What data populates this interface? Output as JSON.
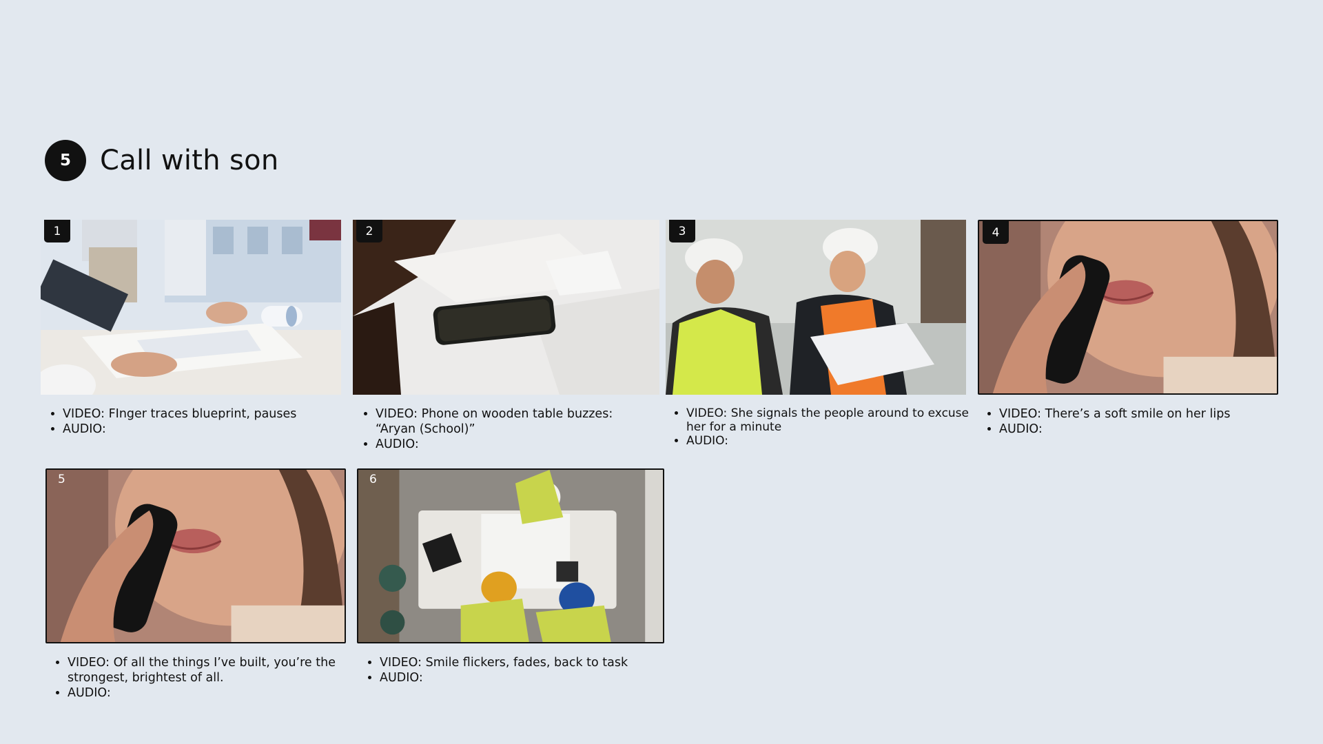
{
  "scene": {
    "number": "5",
    "title": "Call with son"
  },
  "shots": [
    {
      "number": "1",
      "image": "hands-on-blueprint-image",
      "video": "VIDEO: FInger traces blueprint, pauses",
      "video_cont": "",
      "audio": "AUDIO:"
    },
    {
      "number": "2",
      "image": "phone-on-table-image",
      "video": "VIDEO: Phone on wooden table buzzes:",
      "video_cont": "“Aryan (School)”",
      "audio": "AUDIO:"
    },
    {
      "number": "3",
      "image": "construction-workers-image",
      "video": "VIDEO: She signals the people around to excuse",
      "video_cont": "her for a minute",
      "audio": "AUDIO:"
    },
    {
      "number": "4",
      "image": "woman-on-phone-image",
      "video": "VIDEO: There’s a soft smile on her lips",
      "video_cont": "",
      "audio": "AUDIO:"
    },
    {
      "number": "5",
      "image": "woman-on-phone-image",
      "video": "VIDEO: Of all the things I’ve built, you’re the",
      "video_cont": "strongest, brightest of all.",
      "audio": "AUDIO:"
    },
    {
      "number": "6",
      "image": "overhead-workers-table-image",
      "video": "VIDEO: Smile flickers, fades, back to task",
      "video_cont": "",
      "audio": "AUDIO:"
    }
  ]
}
